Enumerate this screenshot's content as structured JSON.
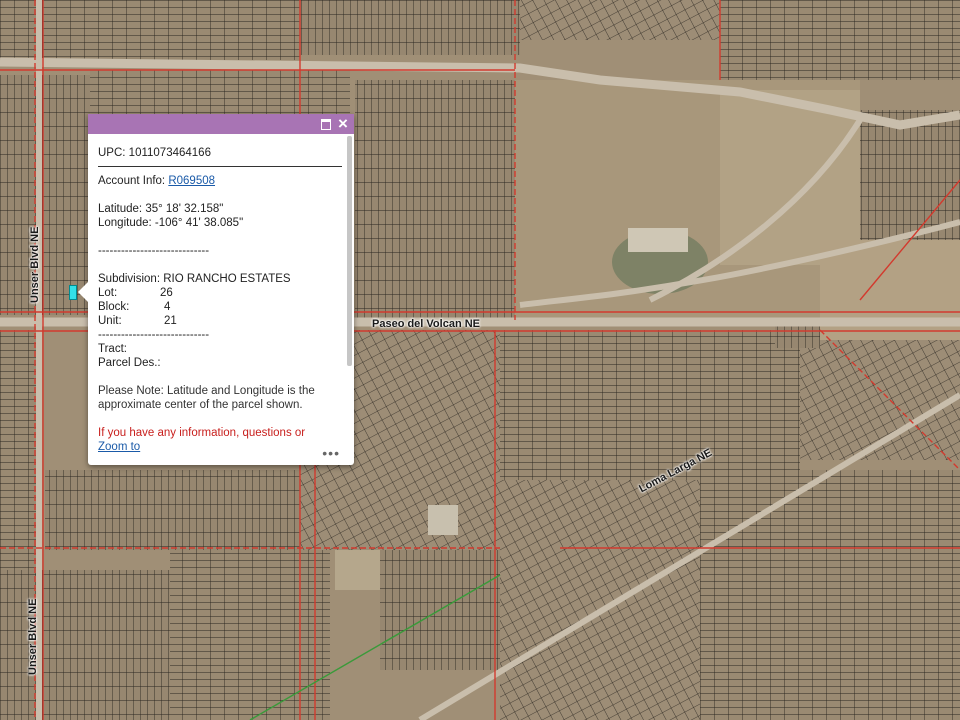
{
  "map": {
    "road_labels": {
      "paseo": "Paseo del Volcan NE",
      "unser_upper": "Unser Blvd NE",
      "unser_lower": "Unser Blvd NE",
      "diagonal": "Loma Larga NE"
    },
    "colors": {
      "terrain": "#9c8c74",
      "parcel_line": "#2a2620",
      "boundary": "#d23a2e",
      "selected_parcel": "#33e0e8"
    }
  },
  "popup": {
    "header_color": "#a874b4",
    "maximize_icon": "maximize-icon",
    "close_icon": "close-icon",
    "upc": "UPC: 1011073464166",
    "account_label": "Account Info: ",
    "account_link": "R069508",
    "latitude": "Latitude: 35° 18' 32.158\"",
    "longitude": "Longitude: -106° 41' 38.085\"",
    "divider": "-----------------------------",
    "subdivision": "Subdivision: RIO RANCHO ESTATES",
    "lot_label": "Lot:",
    "lot_value": "26",
    "block_label": "Block:",
    "block_value": "4",
    "unit_label": "Unit:",
    "unit_value": "21",
    "divider2": "-----------------------------",
    "tract_label": "Tract:",
    "parcel_des_label": "Parcel Des.:",
    "note": "Please Note: Latitude and Longitude is the approximate center of the parcel shown.",
    "info_red": "If you have any information, questions or",
    "zoom_link": "Zoom to",
    "more_icon": "•••"
  }
}
